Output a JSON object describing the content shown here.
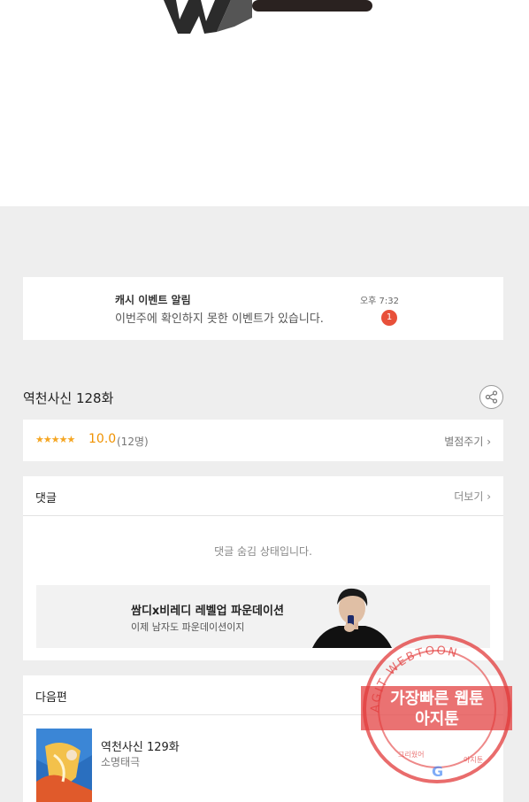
{
  "notice": {
    "title": "캐시 이벤트 알림",
    "message": "이번주에 확인하지 못한 이벤트가 있습니다.",
    "time": "오후 7:32",
    "badge_count": "1"
  },
  "episode": {
    "title": "역천사신 128화",
    "stars": "★★★★★",
    "score": "10.0",
    "count": "(12명)",
    "rate_label": "별점주기 ›"
  },
  "comments": {
    "heading": "댓글",
    "more_label": "더보기 ›",
    "hidden_message": "댓글 숨김 상태입니다."
  },
  "ad": {
    "headline": "쌈디x비레디 레벨업 파운데이션",
    "subline": "이제 남자도 파운데이션이지"
  },
  "next": {
    "heading": "다음편",
    "title": "역천사신 129화",
    "author": "소명태극"
  },
  "watermark": {
    "line1": "가장빠른 웹툰",
    "line2": "아지툰",
    "ring_text": "AGIT WEBTOON",
    "small_left": "그리웠어",
    "small_right": "아지툰",
    "g": "G"
  },
  "colors": {
    "accent_orange": "#f09200",
    "badge_red": "#e8503a",
    "stamp_red": "#e23b3b"
  }
}
